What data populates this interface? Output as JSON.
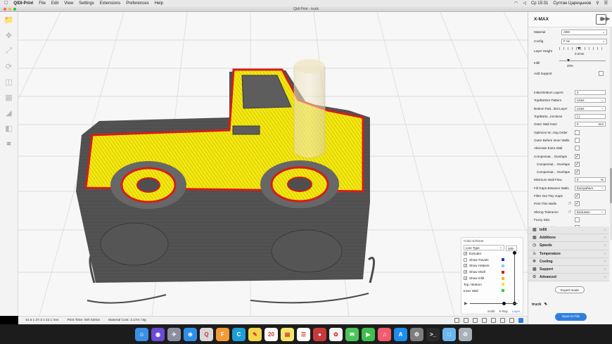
{
  "menubar": {
    "app_name": "QIDI-Print",
    "items": [
      "File",
      "Edit",
      "View",
      "Settings",
      "Extensions",
      "Preferences",
      "Help"
    ],
    "clock": "Ср 15:31",
    "user": "Султан Царицынов"
  },
  "window": {
    "title": "Qidi Print - truck"
  },
  "left_tools": [
    "open-file-icon",
    "move-icon",
    "scale-icon",
    "rotate-icon",
    "mirror-icon",
    "per-model-settings-icon",
    "support-blocker-icon",
    "layer-icon",
    "wifi-icon"
  ],
  "printer": {
    "name": "X-MAX",
    "icon_label": "X"
  },
  "material": {
    "label": "Material",
    "value": "ABS"
  },
  "config": {
    "label": "Config",
    "value": "F ne"
  },
  "layer_height": {
    "label": "Layer Height",
    "value": "0.2mm"
  },
  "infill": {
    "label": "Infill",
    "value": "20%"
  },
  "add_support": {
    "label": "Add Support"
  },
  "settings": [
    {
      "label": "Initial Bottom Layers",
      "type": "input",
      "value": "2"
    },
    {
      "label": "Top/Bottom Pattern",
      "type": "select",
      "value": "Lines"
    },
    {
      "label": "Bottom Patt...itial Layer",
      "type": "select",
      "value": "Lines"
    },
    {
      "label": "Top/Botto...irections",
      "type": "input",
      "value": "[ ]"
    },
    {
      "label": "Outer Wall Inset",
      "type": "input",
      "value": "0",
      "unit": "mm"
    },
    {
      "label": "Optimize W...ting Order",
      "type": "check",
      "checked": false
    },
    {
      "label": "Outer Before Inner Walls",
      "type": "check",
      "checked": false
    },
    {
      "label": "Alternate Extra Wall",
      "type": "check",
      "checked": false
    },
    {
      "label": "Compensat... Overlaps",
      "type": "check",
      "checked": true
    },
    {
      "label": "Compensat... Overlaps",
      "type": "check",
      "checked": true,
      "indent": true
    },
    {
      "label": "Compensat... Overlaps",
      "type": "check",
      "checked": true,
      "indent": true
    },
    {
      "label": "Minimum Wall Flow",
      "type": "input",
      "value": "0",
      "unit": "%"
    },
    {
      "label": "Fill Gaps Between Walls",
      "type": "select",
      "value": "Everywhere"
    },
    {
      "label": "Filter Out Tiny Gaps",
      "type": "check",
      "checked": true
    },
    {
      "label": "Print Thin Walls",
      "type": "check",
      "checked": true,
      "reset": true
    },
    {
      "label": "Slicing Tolerance",
      "type": "select",
      "value": "Exclusive",
      "reset": true
    },
    {
      "label": "Fuzzy Skin",
      "type": "check",
      "checked": false
    },
    {
      "label": "Try Multip...hicknesses",
      "type": "check",
      "checked": false
    }
  ],
  "categories": [
    {
      "label": "Infill",
      "icon": "infill-icon"
    },
    {
      "label": "Additions",
      "icon": "additions-icon"
    },
    {
      "label": "Speeds",
      "icon": "speeds-icon"
    },
    {
      "label": "Temperature",
      "icon": "temperature-icon"
    },
    {
      "label": "Cooling",
      "icon": "cooling-icon"
    },
    {
      "label": "Support",
      "icon": "support-icon"
    },
    {
      "label": "Advanced",
      "icon": "advanced-icon"
    }
  ],
  "expert_mode": "Expert mode",
  "job_name": "truck",
  "save_button": "Save to File",
  "color_scheme": {
    "title": "Color scheme",
    "selected": "Line Type",
    "layer_number": "109",
    "items": [
      {
        "label": "Extruder",
        "checked": true,
        "color": ""
      },
      {
        "label": "Show Travels",
        "checked": false,
        "color": "#1a34c8"
      },
      {
        "label": "Show Helpers",
        "checked": true,
        "color": "#7fd3ea"
      },
      {
        "label": "Show Shell",
        "checked": true,
        "color": "#d41c1c"
      },
      {
        "label": "Show Infill",
        "checked": true,
        "color": "#f2b92a"
      },
      {
        "label": "Top / Bottom",
        "checked": null,
        "color": "#f7e81c"
      },
      {
        "label": "Inner Wall",
        "checked": null,
        "color": "#2cd13a"
      }
    ],
    "view_modes": [
      "Solid",
      "X-Ray",
      "Layer"
    ],
    "active_view_mode": "Layer"
  },
  "status": {
    "dimensions": "44.6 x 37.3 x 22.1 mm",
    "print_time": "Print Time: 00h 53min",
    "material_cost": "Material Cost: 3.17m / 8g"
  },
  "dock_apps": [
    "Finder",
    "Siri",
    "Launchpad",
    "Safari",
    "QIDI",
    "Fusion",
    "Cura",
    "Notes",
    "Calendar",
    "Stickies",
    "Reminders",
    "Photo Booth",
    "Photos",
    "Messages",
    "FaceTime",
    "Music",
    "App Store",
    "System Preferences",
    "Terminal",
    "Folder",
    "Trash"
  ],
  "dock_badges": {
    "calendar_day": "20",
    "facetime_badge": "2"
  },
  "colors": {
    "accent": "#2f7fe0",
    "top_surface": "#f2e80f",
    "shell": "#d41c1c",
    "model_gray": "#575757"
  }
}
